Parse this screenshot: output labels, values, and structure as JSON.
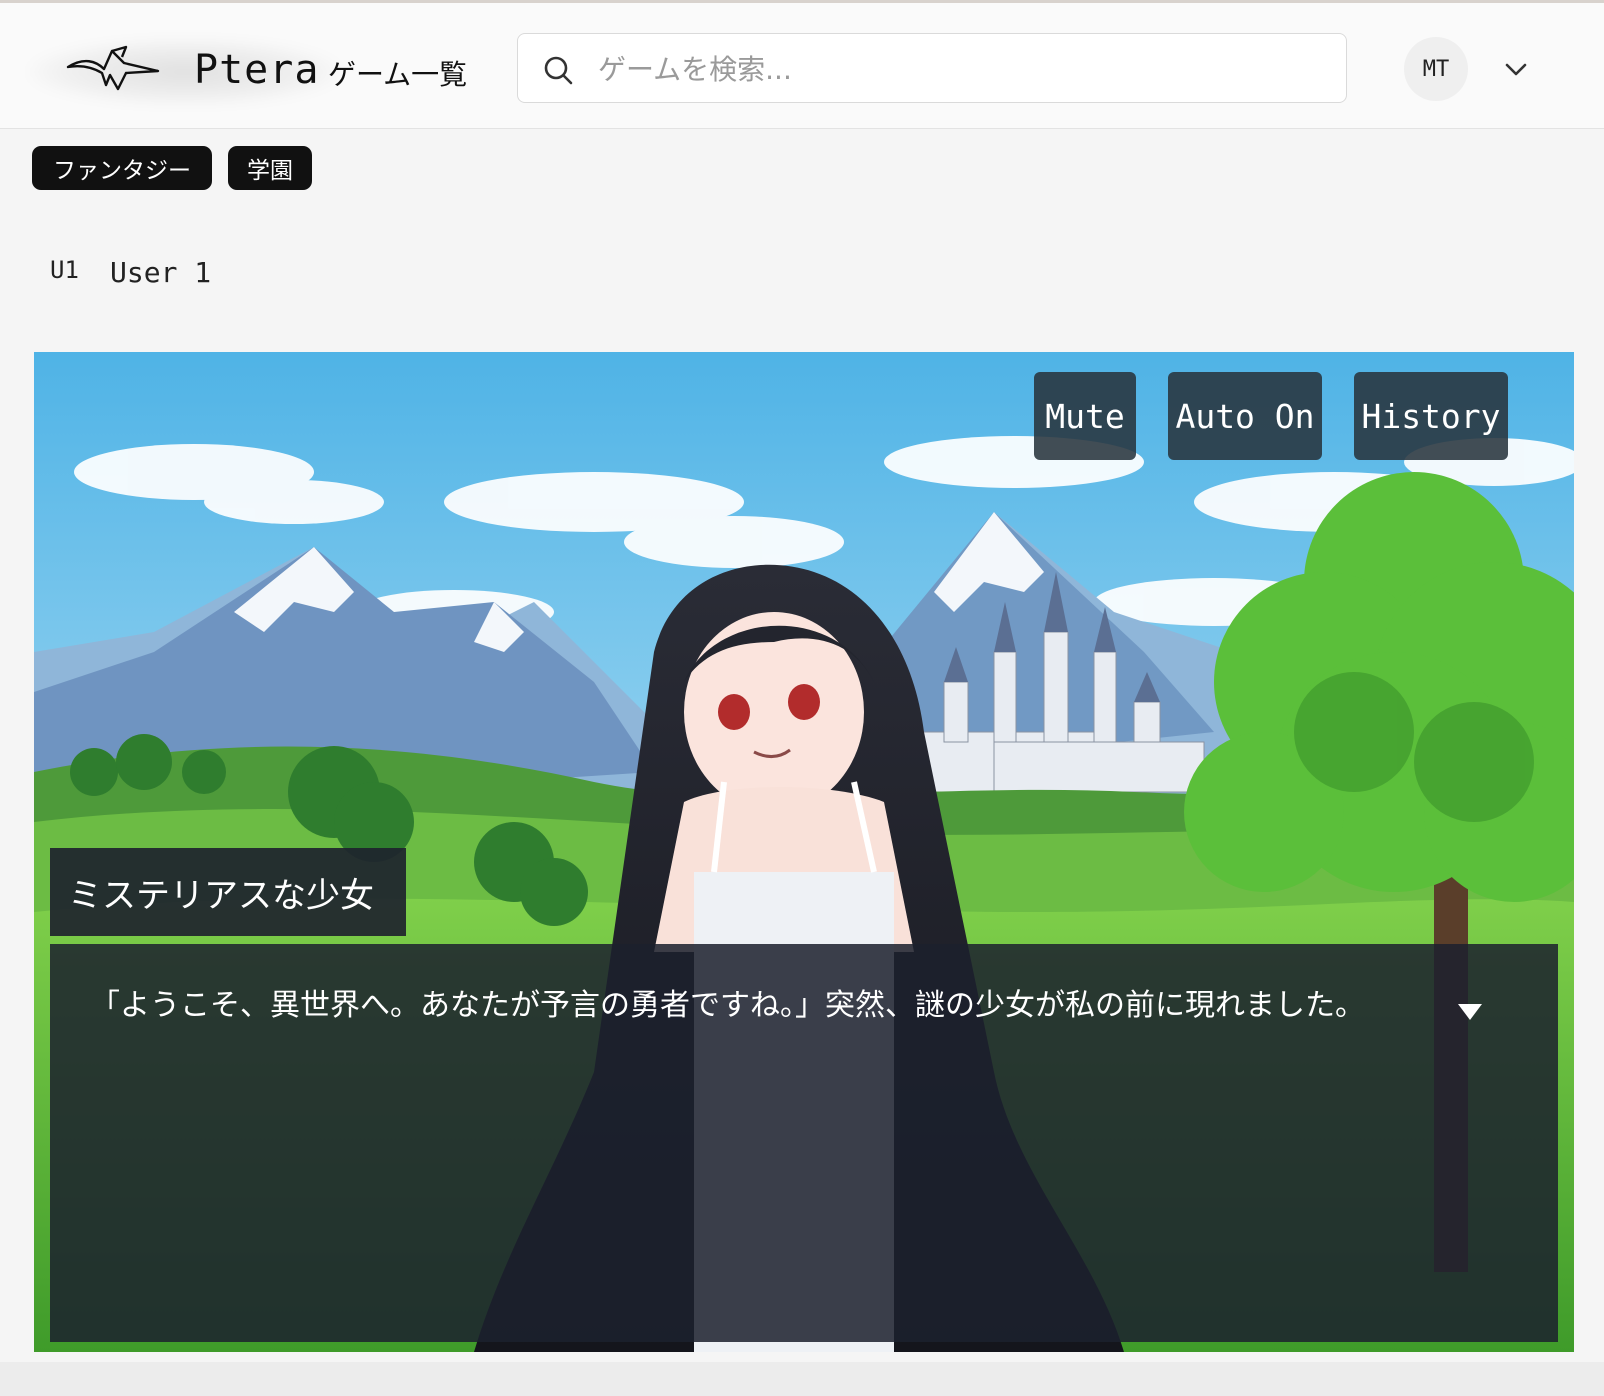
{
  "header": {
    "brand": "Ptera",
    "nav_games": "ゲーム一覧",
    "search_placeholder": "ゲームを検索...",
    "user_initials": "MT"
  },
  "tags": [
    "ファンタジー",
    "学園"
  ],
  "author": {
    "initials": "U1",
    "name": "User 1"
  },
  "game": {
    "controls": {
      "mute": "Mute",
      "auto": "Auto On",
      "history": "History"
    },
    "speaker": "ミステリアスな少女",
    "dialog": "「ようこそ、異世界へ。あなたが予言の勇者ですね。」突然、謎の少女が私の前に現れました。"
  },
  "icons": {
    "logo": "pteranodon-logo-icon",
    "search": "search-icon",
    "user_menu": "chevron-down-icon",
    "next": "triangle-down-icon"
  },
  "colors": {
    "tag_bg": "#111111",
    "control_bg": "#28343e",
    "dialog_bg": "#1c212d"
  }
}
